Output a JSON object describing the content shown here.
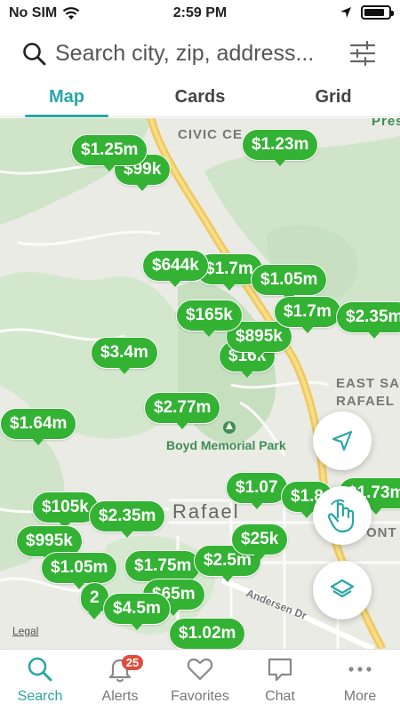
{
  "status": {
    "carrier": "No SIM",
    "time": "2:59 PM"
  },
  "search": {
    "placeholder": "Search city, zip, address..."
  },
  "tabs": [
    "Map",
    "Cards",
    "Grid"
  ],
  "map": {
    "labels": [
      "CIVIC CE",
      "EAST SA",
      "RAFAEL",
      "Rafael",
      "Pres",
      "ONT",
      "Andersen Dr"
    ],
    "park": "Boyd Memorial Park",
    "legal": "Legal",
    "pins": [
      "$1.25m",
      "$99k",
      "$1.23m",
      "$644k",
      "$1.7m",
      "$1.05m",
      "$165k",
      "$1.7m",
      "$2.35m",
      "$895k",
      "$16k",
      "$3.4m",
      "$2.77m",
      "$1.64m",
      "$1.07",
      "$1.8",
      "$1.73m",
      "$105k",
      "$2.35m",
      "$995k",
      "$1.05m",
      "$1.75m",
      "$2.5m",
      "$25k",
      "$4.5m",
      "$1.02m",
      "$65m",
      "2"
    ]
  },
  "tabbar": {
    "items": [
      {
        "label": "Search",
        "icon": "search-icon"
      },
      {
        "label": "Alerts",
        "icon": "bell-icon",
        "badge": "25"
      },
      {
        "label": "Favorites",
        "icon": "heart-icon"
      },
      {
        "label": "Chat",
        "icon": "chat-icon"
      },
      {
        "label": "More",
        "icon": "more-dots-icon"
      }
    ]
  },
  "colors": {
    "accent": "#2aa6a6",
    "pin": "#33b233",
    "badge": "#e24b3b"
  }
}
